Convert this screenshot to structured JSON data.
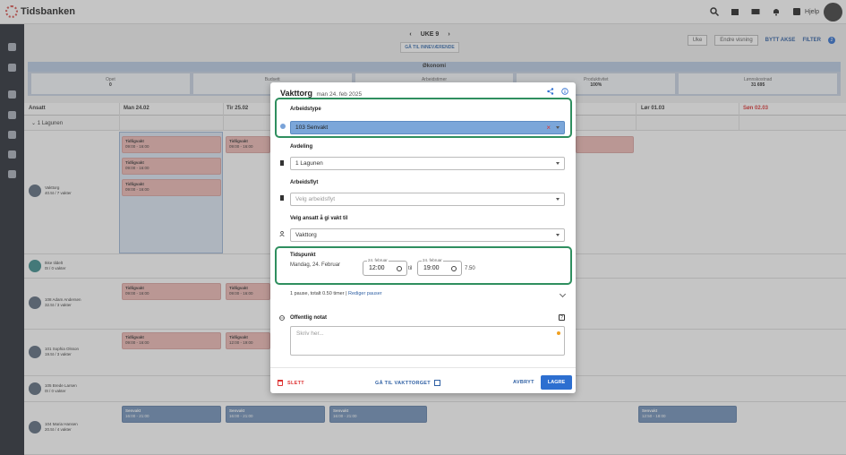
{
  "app": {
    "name": "Tidsbanken"
  },
  "topbar": {
    "help_label": "Hjelp"
  },
  "week": {
    "label": "UKE 9",
    "goto_current": "GÅ TIL INNEVÆRENDE"
  },
  "view": {
    "period": "Uke",
    "change_view": "Endre visning",
    "swap": "BYTT AKSE",
    "filter": "FILTER",
    "filter_count": "2"
  },
  "economy": {
    "title": "Økonomi",
    "cells": [
      {
        "label": "Opet",
        "value": "0"
      },
      {
        "label": "Budsett",
        "value": ""
      },
      {
        "label": "Arbeidstimer",
        "value": ""
      },
      {
        "label": "Produktivitet",
        "value": "100%"
      },
      {
        "label": "Lønnskostnad",
        "value": "31 695"
      }
    ]
  },
  "grid": {
    "employee_header": "Ansatt",
    "days": [
      "Man 24.02",
      "Tir 25.02",
      "Lør 01.03",
      "Søn 02.03"
    ],
    "group": "1 Lagunen",
    "employees": [
      {
        "name": "Vakttorg",
        "hours": "40.5t / 7 vakter"
      },
      {
        "name": "Ikke tildelt",
        "hours": "0t / 0 vakter"
      },
      {
        "name": "108 Adam Andersen",
        "hours": "32.5t / 3 vakter"
      },
      {
        "name": "101 Sophia Olsson",
        "hours": "19.5t / 3 vakter"
      },
      {
        "name": "105 Brede Larsen",
        "hours": "0t / 0 vakter"
      },
      {
        "name": "104 Maria Hansen",
        "hours": "20.5t / 4 vakter"
      }
    ],
    "shift_tidligvakt": "Tidligvakt",
    "time_9_16": "09:00 - 16:00",
    "time_12_19": "12:00 - 19:00",
    "shift_senvakt": "Senvakt",
    "time_16_21": "16:00 - 21:00",
    "time_12_50_18": "12:50 - 18:00"
  },
  "dialog": {
    "title": "Vakttorg",
    "date": "man 24. feb 2025",
    "arbeidstype_label": "Arbeidstype",
    "arbeidstype_value": "103 Senvakt",
    "avdeling_label": "Avdeling",
    "avdeling_value": "1 Lagunen",
    "arbeidsflyt_label": "Arbeidsflyt",
    "arbeidsflyt_placeholder": "Velg arbeidsflyt",
    "ansatt_label": "Velg ansatt å gi vakt til",
    "ansatt_value": "Vakttorg",
    "tidspunkt_label": "Tidspunkt",
    "tidspunkt_date": "Mandag, 24. Februar",
    "start_date_label": "24. februar",
    "start_time": "12:00",
    "til": "til",
    "end_date_label": "24. februar",
    "end_time": "19:00",
    "duration": "7.50",
    "pause_text": "1 pause, totalt 0.50 timer |",
    "pause_link": "Rediger pauser",
    "note_label": "Offentlig notat",
    "note_placeholder": "Skriv her...",
    "delete": "SLETT",
    "goto_vakttorg": "GÅ TIL VAKTTORGET",
    "cancel": "AVBRYT",
    "save": "LAGRE"
  }
}
